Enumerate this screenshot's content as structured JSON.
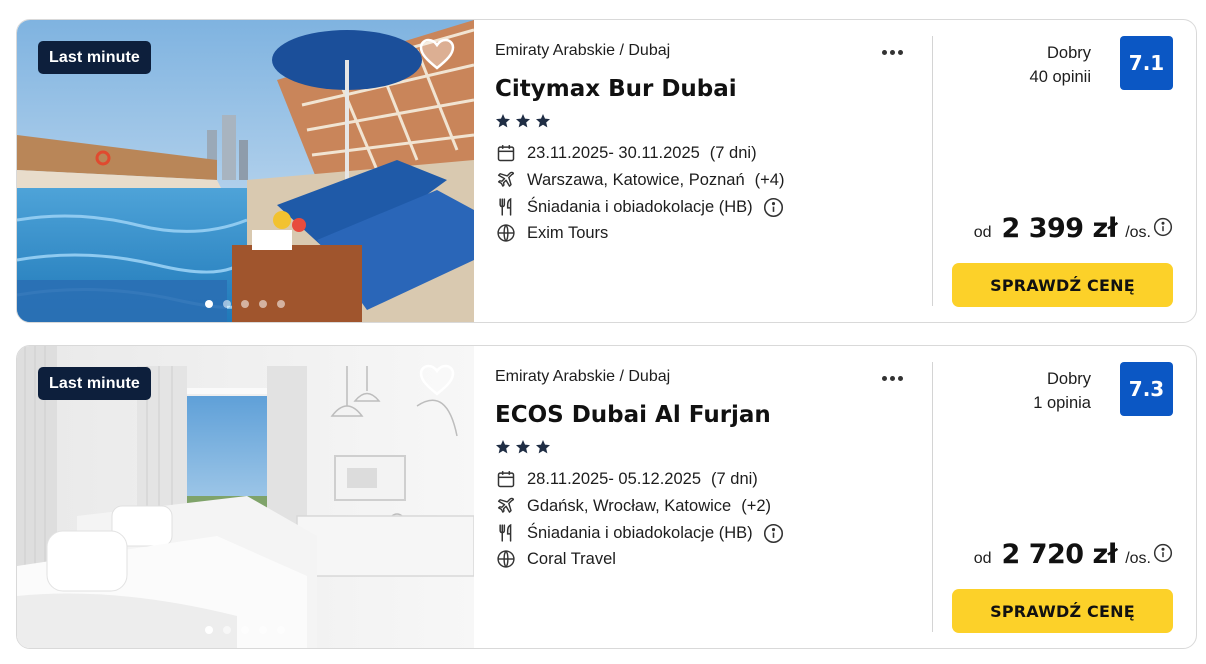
{
  "offers": [
    {
      "badge": "Last minute",
      "region": "Emiraty Arabskie / Dubaj",
      "hotel_name": "Citymax Bur Dubai",
      "stars": 3,
      "dates": "23.11.2025- 30.11.2025",
      "duration": "(7 dni)",
      "departures": "Warszawa, Katowice, Poznań",
      "departures_more": "(+4)",
      "board": "Śniadania i obiadokolacje (HB)",
      "operator": "Exim Tours",
      "rating_word": "Dobry",
      "reviews": "40 opinii",
      "rating": "7.1",
      "price_prefix": "od",
      "price": "2 399 zł",
      "price_suffix": "/os.",
      "cta": "SPRAWDŹ CENĘ",
      "photo_count": 5,
      "active_photo": 1
    },
    {
      "badge": "Last minute",
      "region": "Emiraty Arabskie / Dubaj",
      "hotel_name": "ECOS Dubai Al Furjan",
      "stars": 3,
      "dates": "28.11.2025- 05.12.2025",
      "duration": "(7 dni)",
      "departures": "Gdańsk, Wrocław, Katowice",
      "departures_more": "(+2)",
      "board": "Śniadania i obiadokolacje (HB)",
      "operator": "Coral Travel",
      "rating_word": "Dobry",
      "reviews": "1 opinia",
      "rating": "7.3",
      "price_prefix": "od",
      "price": "2 720 zł",
      "price_suffix": "/os.",
      "cta": "SPRAWDŹ CENĘ",
      "photo_count": 5,
      "active_photo": 1
    }
  ],
  "colors": {
    "badge_bg": "#0d1f3c",
    "rating_bg": "#0b57c4",
    "cta_bg": "#fcd129",
    "star": "#1f2d44"
  },
  "icons": {
    "favorite": "heart-outline-icon",
    "more": "more-dots-icon",
    "dates": "calendar-icon",
    "departures": "plane-icon",
    "board": "cutlery-icon",
    "operator": "globe-icon",
    "info": "info-circle-icon"
  }
}
